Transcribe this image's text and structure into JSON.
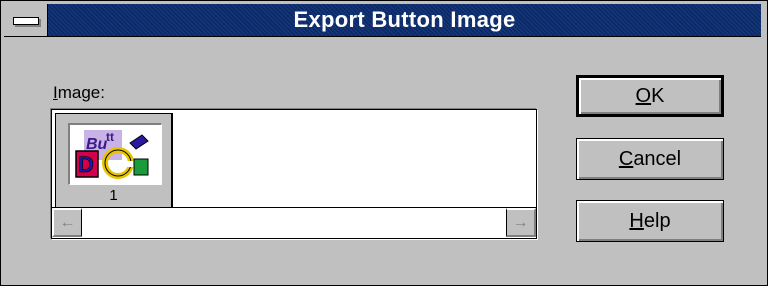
{
  "window": {
    "title": "Export Button Image"
  },
  "image_list": {
    "label_hotkey": "I",
    "label_rest": "mage:",
    "items": [
      {
        "number": "1",
        "thumbnail_icon": "button-image-thumbnail"
      }
    ],
    "scroll_left_icon": "arrow-left-icon",
    "scroll_right_icon": "arrow-right-icon"
  },
  "buttons": {
    "ok": {
      "hotkey": "O",
      "rest": "K"
    },
    "cancel": {
      "hotkey": "C",
      "rest": "ancel"
    },
    "help": {
      "hotkey": "H",
      "rest": "elp"
    }
  },
  "colors": {
    "title_bar": "#0a2a6b",
    "dialog_face": "#c0c0c0"
  }
}
